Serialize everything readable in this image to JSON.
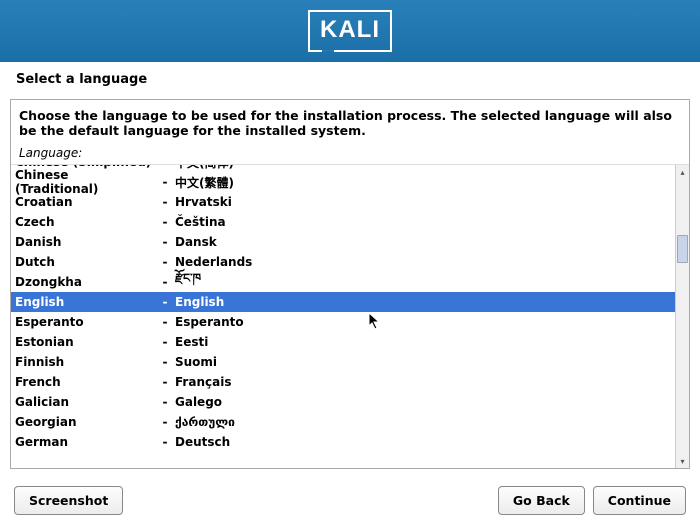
{
  "header": {
    "logo": "KALI"
  },
  "title": "Select a language",
  "description": "Choose the language to be used for the installation process. The selected language will also be the default language for the installed system.",
  "language_label": "Language:",
  "selected_index": 7,
  "languages": [
    {
      "name": "Chinese (Simplified)",
      "dash": "-",
      "native": "中文(简体)"
    },
    {
      "name": "Chinese (Traditional)",
      "dash": "-",
      "native": "中文(繁體)"
    },
    {
      "name": "Croatian",
      "dash": "-",
      "native": "Hrvatski"
    },
    {
      "name": "Czech",
      "dash": "-",
      "native": "Čeština"
    },
    {
      "name": "Danish",
      "dash": "-",
      "native": "Dansk"
    },
    {
      "name": "Dutch",
      "dash": "-",
      "native": "Nederlands"
    },
    {
      "name": "Dzongkha",
      "dash": "-",
      "native": "རྫོང་ཁ"
    },
    {
      "name": "English",
      "dash": "-",
      "native": "English"
    },
    {
      "name": "Esperanto",
      "dash": "-",
      "native": "Esperanto"
    },
    {
      "name": "Estonian",
      "dash": "-",
      "native": "Eesti"
    },
    {
      "name": "Finnish",
      "dash": "-",
      "native": "Suomi"
    },
    {
      "name": "French",
      "dash": "-",
      "native": "Français"
    },
    {
      "name": "Galician",
      "dash": "-",
      "native": "Galego"
    },
    {
      "name": "Georgian",
      "dash": "-",
      "native": "ქართული"
    },
    {
      "name": "German",
      "dash": "-",
      "native": "Deutsch"
    }
  ],
  "buttons": {
    "screenshot": "Screenshot",
    "go_back": "Go Back",
    "continue": "Continue"
  }
}
